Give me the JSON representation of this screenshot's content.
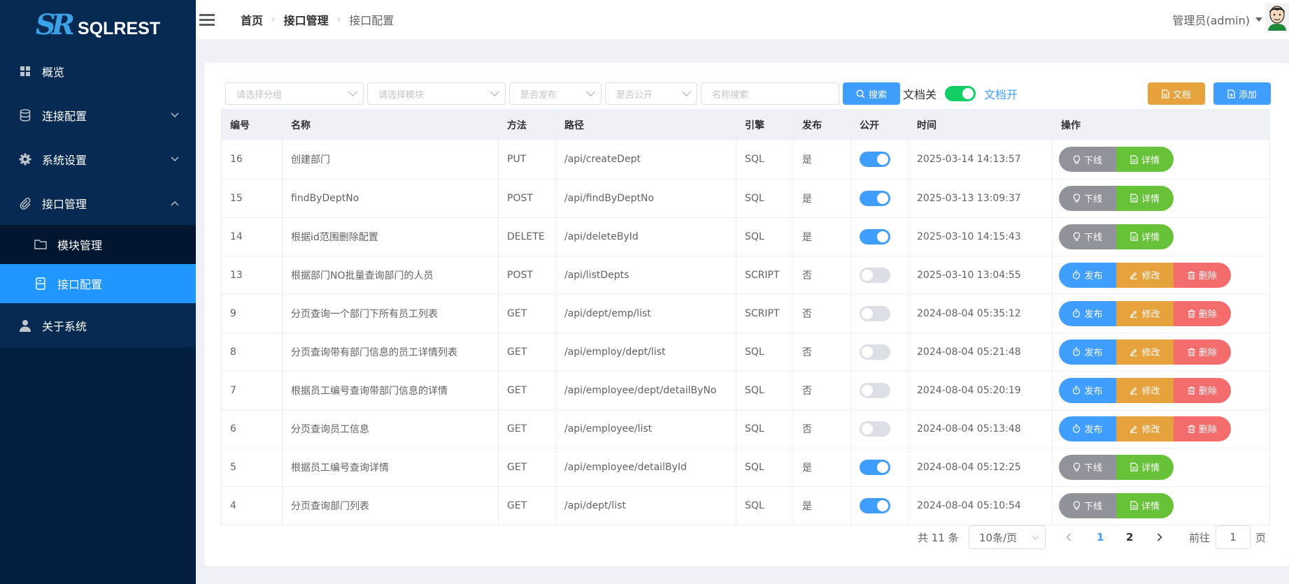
{
  "app": {
    "logo_mark": "SR",
    "logo_text": "SQLREST"
  },
  "sidebar": {
    "items": [
      {
        "label": "概览",
        "icon": "dashboard-icon"
      },
      {
        "label": "连接配置",
        "icon": "database-icon",
        "caret": "chevron-down"
      },
      {
        "label": "系统设置",
        "icon": "gear-icon",
        "caret": "chevron-down"
      },
      {
        "label": "接口管理",
        "icon": "paperclip-icon",
        "caret": "chevron-up"
      }
    ],
    "sub_items": [
      {
        "label": "模块管理",
        "icon": "folder-icon"
      },
      {
        "label": "接口配置",
        "icon": "file-icon",
        "active": true
      }
    ],
    "about": {
      "label": "关于系统",
      "icon": "user-icon"
    }
  },
  "header": {
    "breadcrumb": [
      "首页",
      "接口管理",
      "接口配置"
    ],
    "user": "管理员(admin)"
  },
  "filters": {
    "group_placeholder": "请选择分组",
    "module_placeholder": "请选择模块",
    "publish_placeholder": "是否发布",
    "public_placeholder": "是否公开",
    "name_placeholder": "名称搜索",
    "search_label": "搜索",
    "doc_off_label": "文档关",
    "doc_on_label": "文档开",
    "doc_switch_on": true,
    "doc_button": "文档",
    "add_button": "添加"
  },
  "table": {
    "headers": [
      "编号",
      "名称",
      "方法",
      "路径",
      "引擎",
      "发布",
      "公开",
      "时间",
      "操作"
    ],
    "rows": [
      {
        "id": "16",
        "name": "创建部门",
        "method": "PUT",
        "path": "/api/createDept",
        "engine": "SQL",
        "published": "是",
        "public": true,
        "time": "2025-03-14 14:13:57"
      },
      {
        "id": "15",
        "name": "findByDeptNo",
        "method": "POST",
        "path": "/api/findByDeptNo",
        "engine": "SQL",
        "published": "是",
        "public": true,
        "time": "2025-03-13 13:09:37"
      },
      {
        "id": "14",
        "name": "根据id范围删除配置",
        "method": "DELETE",
        "path": "/api/deleteById",
        "engine": "SQL",
        "published": "是",
        "public": true,
        "time": "2025-03-10 14:15:43"
      },
      {
        "id": "13",
        "name": "根据部门NO批量查询部门的人员",
        "method": "POST",
        "path": "/api/listDepts",
        "engine": "SCRIPT",
        "published": "否",
        "public": false,
        "time": "2025-03-10 13:04:55"
      },
      {
        "id": "9",
        "name": "分页查询一个部门下所有员工列表",
        "method": "GET",
        "path": "/api/dept/emp/list",
        "engine": "SCRIPT",
        "published": "否",
        "public": false,
        "time": "2024-08-04 05:35:12"
      },
      {
        "id": "8",
        "name": "分页查询带有部门信息的员工详情列表",
        "method": "GET",
        "path": "/api/employ/dept/list",
        "engine": "SQL",
        "published": "否",
        "public": false,
        "time": "2024-08-04 05:21:48"
      },
      {
        "id": "7",
        "name": "根据员工编号查询带部门信息的详情",
        "method": "GET",
        "path": "/api/employee/dept/detailByNo",
        "engine": "SQL",
        "published": "否",
        "public": false,
        "time": "2024-08-04 05:20:19"
      },
      {
        "id": "6",
        "name": "分页查询员工信息",
        "method": "GET",
        "path": "/api/employee/list",
        "engine": "SQL",
        "published": "否",
        "public": false,
        "time": "2024-08-04 05:13:48"
      },
      {
        "id": "5",
        "name": "根据员工编号查询详情",
        "method": "GET",
        "path": "/api/employee/detailById",
        "engine": "SQL",
        "published": "是",
        "public": true,
        "time": "2024-08-04 05:12:25"
      },
      {
        "id": "4",
        "name": "分页查询部门列表",
        "method": "GET",
        "path": "/api/dept/list",
        "engine": "SQL",
        "published": "是",
        "public": true,
        "time": "2024-08-04 05:10:54"
      }
    ],
    "actions_published": [
      "下线",
      "详情"
    ],
    "actions_unpublished": [
      "发布",
      "修改",
      "删除"
    ]
  },
  "pagination": {
    "total": "共 11 条",
    "page_size": "10条/页",
    "pages": [
      "1",
      "2"
    ],
    "current": "1",
    "goto_label": "前往",
    "goto_value": "1",
    "page_suffix": "页"
  },
  "colors": {
    "sidebar_bg": "#031f3f",
    "active": "#1f97fd",
    "primary": "#409eff",
    "warning": "#e6a23c",
    "danger": "#f56c6c",
    "success": "#67c23a",
    "info": "#909399"
  }
}
